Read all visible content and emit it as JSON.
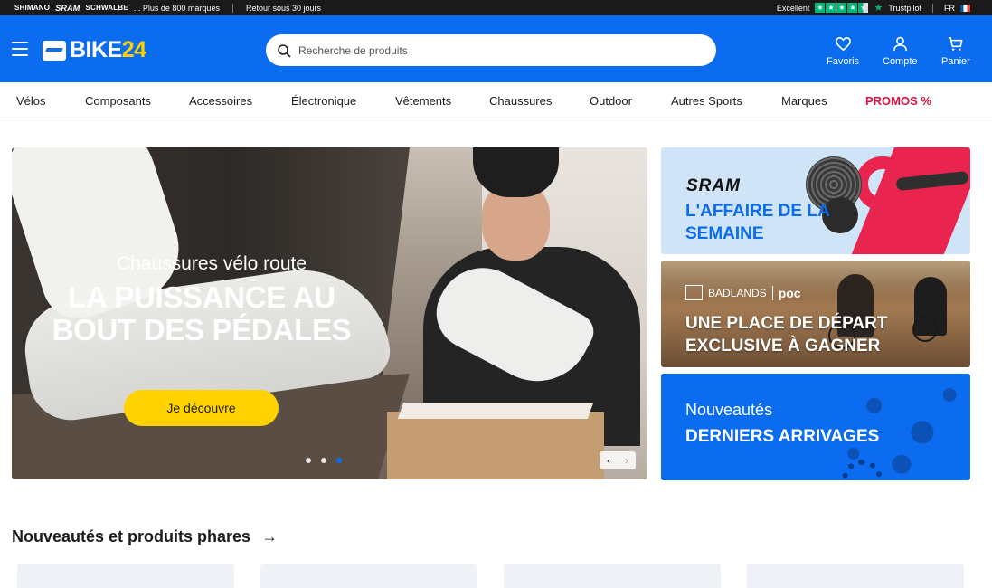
{
  "topbar": {
    "brands": [
      "SHIMANO",
      "SRAM",
      "SCHWALBE"
    ],
    "brands_more": "... Plus de 800 marques",
    "returns": "Retour sous 30 jours",
    "rating_label": "Excellent",
    "rating_stars": 4.5,
    "trustpilot": "Trustpilot",
    "lang": "FR"
  },
  "header": {
    "logo_word": "BIKE",
    "logo_number": "24",
    "search_placeholder": "Recherche de produits",
    "favorites": "Favoris",
    "account": "Compte",
    "cart": "Panier"
  },
  "nav": {
    "items": [
      "Vélos",
      "Composants",
      "Accessoires",
      "Électronique",
      "Vêtements",
      "Chaussures",
      "Outdoor",
      "Autres Sports",
      "Marques"
    ],
    "promo": "PROMOS %"
  },
  "hero": {
    "subtitle": "Chaussures vélo route",
    "title": "LA PUISSANCE AU BOUT DES PÉDALES",
    "cta": "Je découvre",
    "slides": 3,
    "active_slide": 3,
    "prev": "‹",
    "next": "›"
  },
  "promos": {
    "card1": {
      "brand": "SRAM",
      "title": "L'AFFAIRE DE LA SEMAINE"
    },
    "card2": {
      "brand1": "BADLANDS",
      "brand2": "poc",
      "title": "UNE PLACE DE DÉPART EXCLUSIVE À GAGNER"
    },
    "card3": {
      "subtitle": "Nouveautés",
      "title": "DERNIERS ARRIVAGES"
    }
  },
  "section": {
    "title": "Nouveautés et produits phares",
    "arrow": "→"
  },
  "colors": {
    "brand_blue": "#0b6cf0",
    "accent_yellow": "#ffd200",
    "promo_red": "#e0113f",
    "trustpilot_green": "#00b67a"
  }
}
